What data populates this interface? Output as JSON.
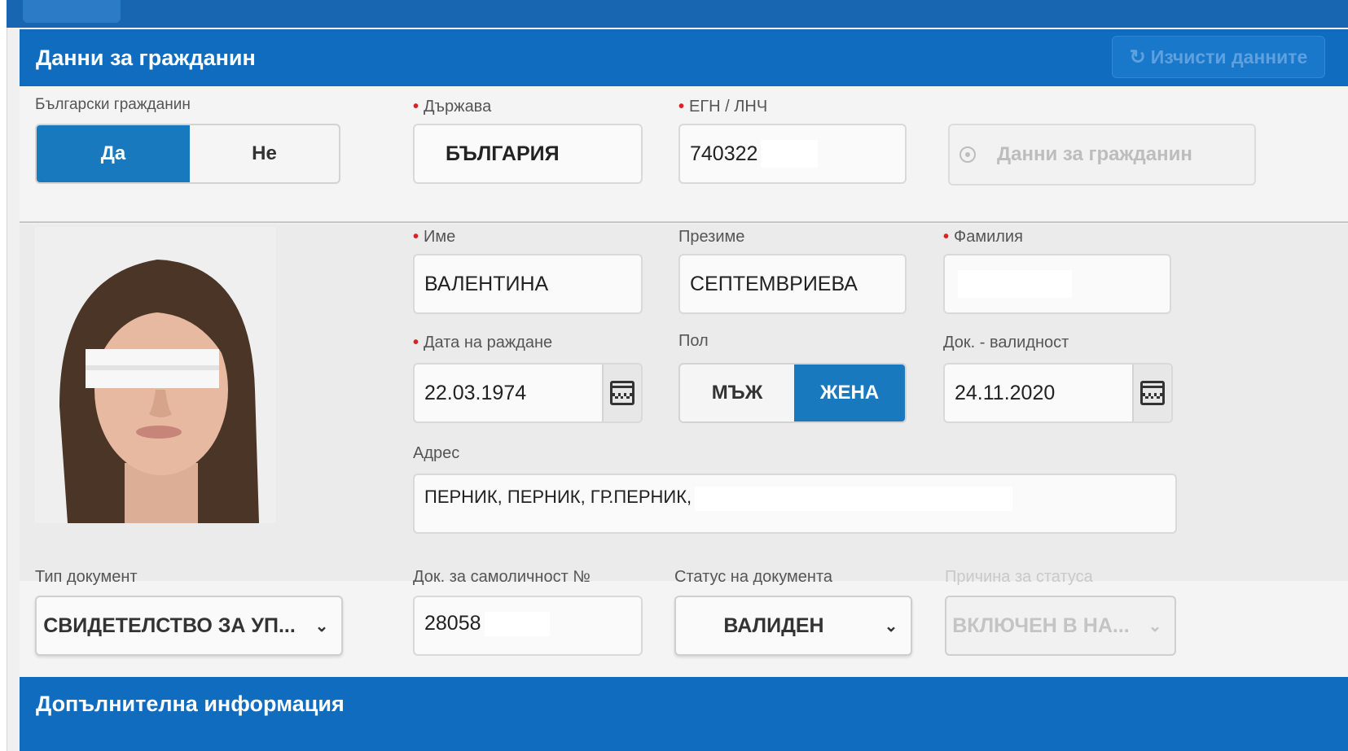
{
  "header": {
    "title": "Данни за гражданин",
    "clear_button": "Изчисти данните",
    "clear_icon": "refresh-icon"
  },
  "citizen": {
    "bulgarian_label": "Български гражданин",
    "yes": "Да",
    "no": "Не",
    "bulgarian_selected": "Да",
    "country_label": "Държава",
    "country_value": "БЪЛГАРИЯ",
    "egn_label": "ЕГН / ЛНЧ",
    "egn_value": "740322",
    "lookup_button": "Данни за гражданин"
  },
  "person": {
    "first_name_label": "Име",
    "first_name": "ВАЛЕНТИНА",
    "middle_name_label": "Презиме",
    "middle_name": "СЕПТЕМВРИЕВА",
    "last_name_label": "Фамилия",
    "last_name": "",
    "birthdate_label": "Дата на раждане",
    "birthdate": "22.03.1974",
    "sex_label": "Пол",
    "male": "МЪЖ",
    "female": "ЖЕНА",
    "sex_selected": "ЖЕНА",
    "validity_label": "Док. - валидност",
    "validity": "24.11.2020",
    "address_label": "Адрес",
    "address": "ПЕРНИК, ПЕРНИК, ГР.ПЕРНИК,"
  },
  "document": {
    "type_label": "Тип документ",
    "type_value": "СВИДЕТЕЛСТВО ЗА УП...",
    "number_label": "Док. за самоличност №",
    "number_value": "28058",
    "status_label": "Статус на документа",
    "status_value": "ВАЛИДЕН",
    "reason_label": "Причина за статуса",
    "reason_value": "ВКЛЮЧЕН В НА..."
  },
  "footer": {
    "title": "Допълнителна информация"
  },
  "colors": {
    "header_blue": "#0f6cbf",
    "active_toggle": "#1879bf",
    "required_dot": "#d42424"
  }
}
